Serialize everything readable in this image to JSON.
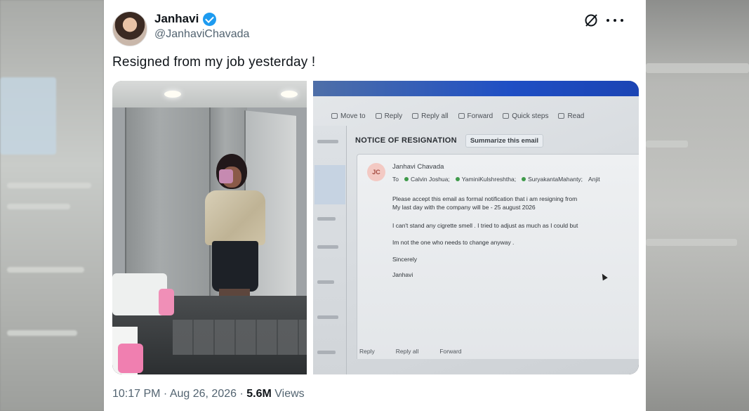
{
  "author": {
    "display_name": "Janhavi",
    "handle": "@JanhaviChavada"
  },
  "tweet": {
    "text": "Resigned from my job yesterday !",
    "time": "10:17 PM",
    "separator1": " · ",
    "date": "Aug 26, 2026",
    "separator2": " · ",
    "views_count": "5.6M",
    "views_label": " Views"
  },
  "icons": {
    "verified": "verified-badge-icon",
    "grok": "grok-icon",
    "more": "more-icon"
  },
  "colors": {
    "verified": "#1d9bf0",
    "text": "#0f1419",
    "muted": "#536471"
  },
  "email_photo": {
    "ribbon": [
      "Move to",
      "Reply",
      "Reply all",
      "Forward",
      "Quick steps",
      "Read"
    ],
    "subject": "NOTICE OF RESIGNATION",
    "summarize": "Summarize this email",
    "avatar_initials": "JC",
    "sender": "Janhavi Chavada",
    "to_label": "To",
    "recipients": [
      "Calvin Joshua;",
      "YaminiKulshreshtha;",
      "SuryakantaMahanty;",
      "Anjit"
    ],
    "body": [
      "Please accept this email as formal notification that i am resigning from",
      "My last day with the company will be -  25 august 2026",
      "I can't stand any cigrette smell .  I tried to adjust as much as I could but",
      "Im not the one who needs to change anyway .",
      "Sincerely",
      "Janhavi"
    ],
    "actions": [
      "Reply",
      "Reply all",
      "Forward"
    ]
  }
}
